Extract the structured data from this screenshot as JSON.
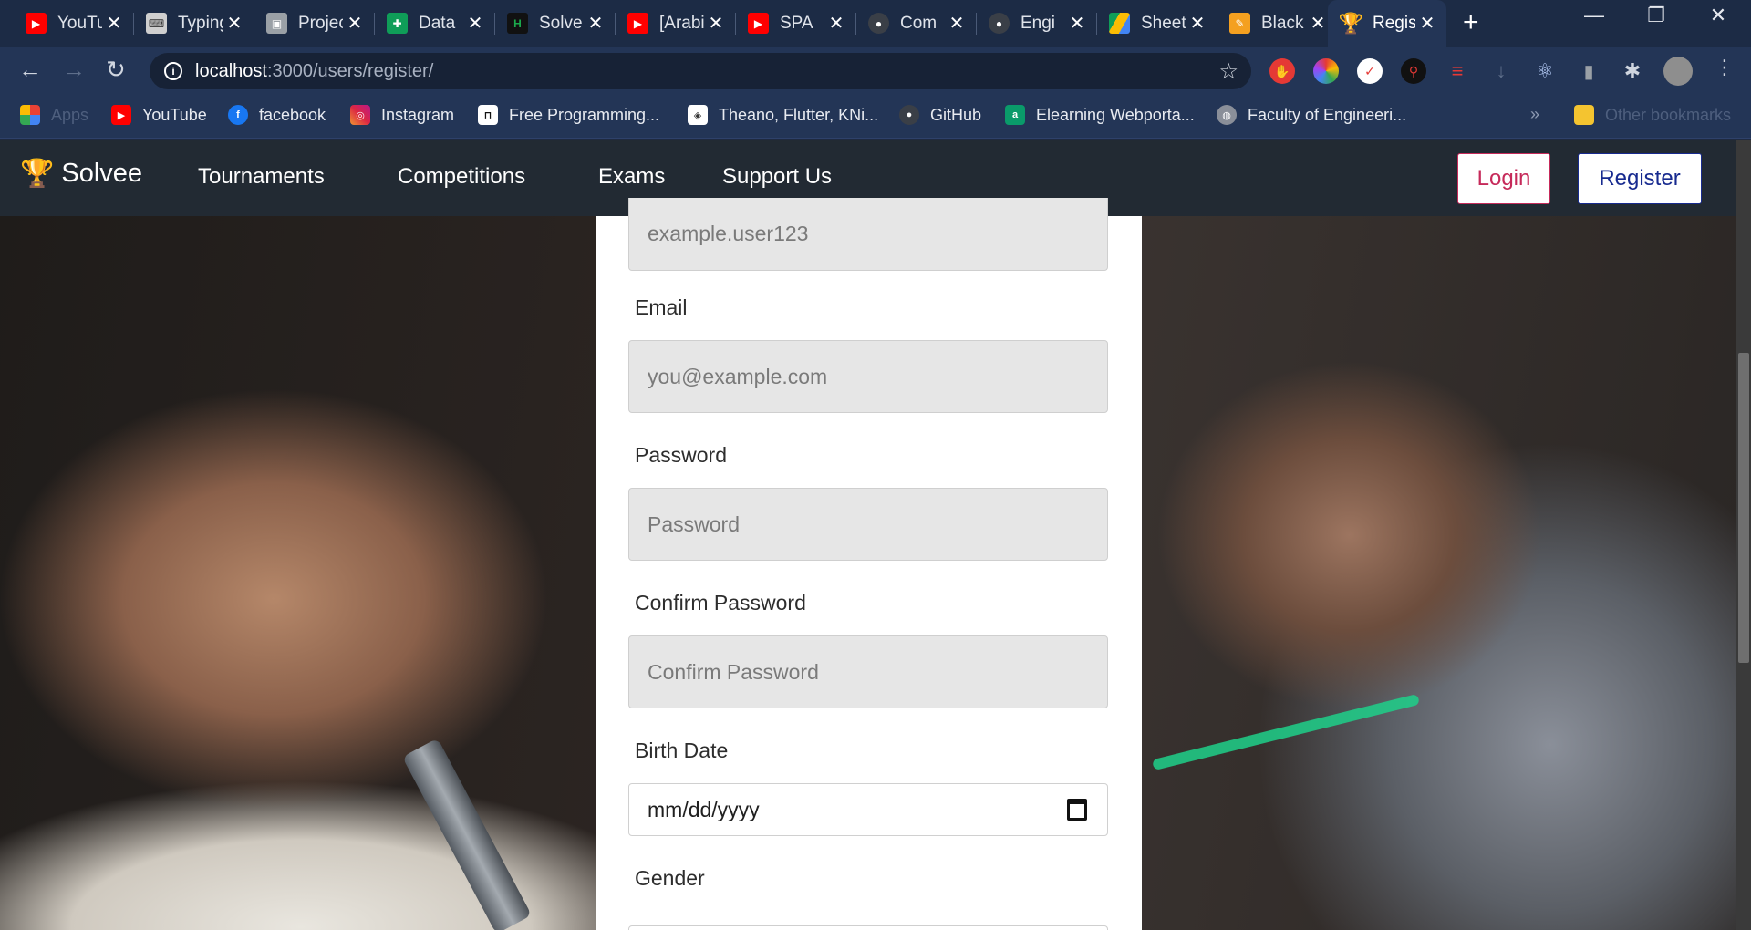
{
  "browser": {
    "tabs": [
      {
        "label": "YouTube",
        "icon": "youtube-icon",
        "color": "#ff0000"
      },
      {
        "label": "Typing",
        "icon": "typing-icon",
        "color": "#cccccc"
      },
      {
        "label": "Projects",
        "icon": "contact-icon",
        "color": "#cccccc"
      },
      {
        "label": "Data",
        "icon": "sheets-icon",
        "color": "#0f9d58"
      },
      {
        "label": "Solve",
        "icon": "hackerrank-icon",
        "color": "#1ba94c"
      },
      {
        "label": "[Arabic]",
        "icon": "youtube-icon",
        "color": "#ff0000"
      },
      {
        "label": "SPA",
        "icon": "youtube-icon",
        "color": "#ff0000"
      },
      {
        "label": "Com",
        "icon": "github-icon",
        "color": "#555555"
      },
      {
        "label": "Engi",
        "icon": "github-icon",
        "color": "#555555"
      },
      {
        "label": "Sheet",
        "icon": "drive-icon",
        "color": "#fbbc04"
      },
      {
        "label": "Black",
        "icon": "pencil-icon",
        "color": "#f4a020"
      },
      {
        "label": "Register",
        "icon": "trophy-icon",
        "color": "#f4a020",
        "active": true
      }
    ],
    "new_tab": "+",
    "window_controls": {
      "minimize": "—",
      "restore": "❐",
      "close": "✕"
    },
    "address": {
      "host": "localhost",
      "path": ":3000/users/register/"
    },
    "bookmarks": [
      {
        "label": "Apps",
        "icon": "apps-grid-icon",
        "color": "#e94235"
      },
      {
        "label": "YouTube",
        "icon": "youtube-icon",
        "color": "#ff0000"
      },
      {
        "label": "facebook",
        "icon": "facebook-icon",
        "color": "#1877f2"
      },
      {
        "label": "Instagram",
        "icon": "instagram-icon",
        "color": "#d6249f"
      },
      {
        "label": "Free Programming...",
        "icon": "free-programming-icon",
        "color": "#111111"
      },
      {
        "label": "Theano, Flutter, KNi...",
        "icon": "theano-icon",
        "color": "#ffffff"
      },
      {
        "label": "GitHub",
        "icon": "github-icon",
        "color": "#333333"
      },
      {
        "label": "Elearning Webporta...",
        "icon": "elearning-icon",
        "color": "#0a9b6a"
      },
      {
        "label": "Faculty of Engineeri...",
        "icon": "globe-icon",
        "color": "#888888"
      }
    ],
    "bookmarks_overflow": "»",
    "other_bookmarks": "Other bookmarks"
  },
  "site": {
    "brand": "Solvee",
    "nav": [
      "Tournaments",
      "Competitions",
      "Exams",
      "Support Us"
    ],
    "login_label": "Login",
    "register_label": "Register"
  },
  "form": {
    "username_placeholder": "example.user123",
    "email_label": "Email",
    "email_placeholder": "you@example.com",
    "password_label": "Password",
    "password_placeholder": "Password",
    "confirm_label": "Confirm Password",
    "confirm_placeholder": "Confirm Password",
    "birth_label": "Birth Date",
    "birth_placeholder": "mm/dd/yyyy",
    "gender_label": "Gender"
  },
  "colors": {
    "tabstrip": "#1c2b45",
    "toolbar": "#233556",
    "navbar": "#222a33",
    "login_accent": "#c62a5a",
    "register_accent": "#172a8f"
  }
}
